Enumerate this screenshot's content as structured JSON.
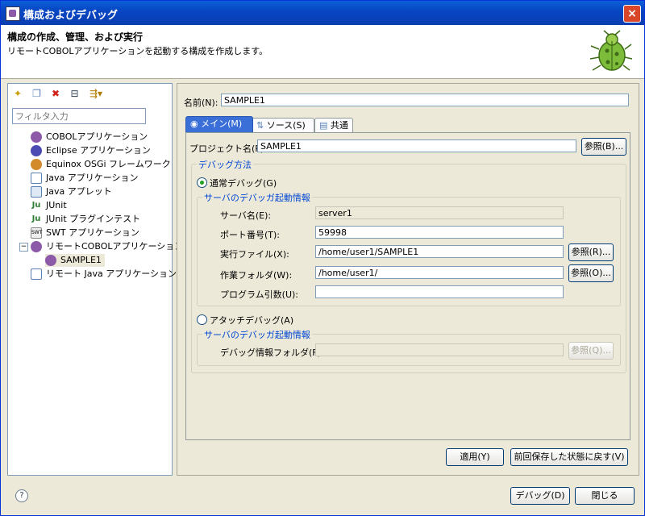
{
  "window": {
    "title": "構成およびデバッグ",
    "close_label": "×"
  },
  "header": {
    "title": "構成の作成、管理、および実行",
    "description": "リモートCOBOLアプリケーションを起動する構成を作成します。"
  },
  "left": {
    "toolbar_icons": [
      "new-config-icon",
      "duplicate-icon",
      "delete-icon",
      "collapse-all-icon",
      "filter-icon"
    ],
    "filter_placeholder": "フィルタ入力",
    "tree": [
      {
        "label": "COBOLアプリケーション",
        "icon": "cobol-app-icon",
        "color": "#8c5aa8"
      },
      {
        "label": "Eclipse アプリケーション",
        "icon": "eclipse-icon",
        "color": "#4b4bb3"
      },
      {
        "label": "Equinox OSGi フレームワーク",
        "icon": "osgi-icon",
        "color": "#d28a2b"
      },
      {
        "label": "Java アプリケーション",
        "icon": "java-app-icon",
        "color": "#5a7fb5"
      },
      {
        "label": "Java アプレット",
        "icon": "java-applet-icon",
        "color": "#5a7fb5"
      },
      {
        "label": "JUnit",
        "icon": "junit-icon",
        "color": "#2e7d32"
      },
      {
        "label": "JUnit プラグインテスト",
        "icon": "junit-plugin-icon",
        "color": "#2e7d32"
      },
      {
        "label": "SWT アプリケーション",
        "icon": "swt-icon",
        "color": "#888888"
      },
      {
        "label": "リモートCOBOLアプリケーション",
        "icon": "remote-cobol-icon",
        "color": "#8c5aa8"
      },
      {
        "label": "SAMPLE1",
        "icon": "remote-cobol-config-icon",
        "color": "#8c5aa8"
      },
      {
        "label": "リモート Java アプリケーション",
        "icon": "remote-java-icon",
        "color": "#5a7fb5"
      }
    ]
  },
  "right": {
    "name_label": "名前(N):",
    "name_value": "SAMPLE1",
    "tabs": [
      "メイン(M)",
      "ソース(S)",
      "共通"
    ],
    "project_label": "プロジェクト名(P):",
    "project_value": "SAMPLE1",
    "browse_label": "参照(B)...",
    "debug_method_title": "デバッグ方法",
    "normal_debug_label": "通常デバッグ(G)",
    "server_info_title": "サーバのデバッガ起動情報",
    "server_name_label": "サーバ名(E):",
    "server_name_value": "server1",
    "port_label": "ポート番号(T):",
    "port_value": "59998",
    "exec_label": "実行ファイル(X):",
    "exec_value": "/home/user1/SAMPLE1",
    "exec_browse": "参照(R)...",
    "work_label": "作業フォルダ(W):",
    "work_value": "/home/user1/",
    "work_browse": "参照(O)...",
    "args_label": "プログラム引数(U):",
    "args_value": "",
    "attach_debug_label": "アタッチデバッグ(A)",
    "server_info_title2": "サーバのデバッガ起動情報",
    "debug_folder_label": "デバッグ情報フォルダ(F):",
    "debug_folder_value": "",
    "debug_folder_browse": "参照(Q)...",
    "apply_label": "適用(Y)",
    "revert_label": "前回保存した状態に戻す(V)"
  },
  "footer": {
    "debug_label": "デバッグ(D)",
    "close_label": "閉じる",
    "help_label": "?"
  }
}
